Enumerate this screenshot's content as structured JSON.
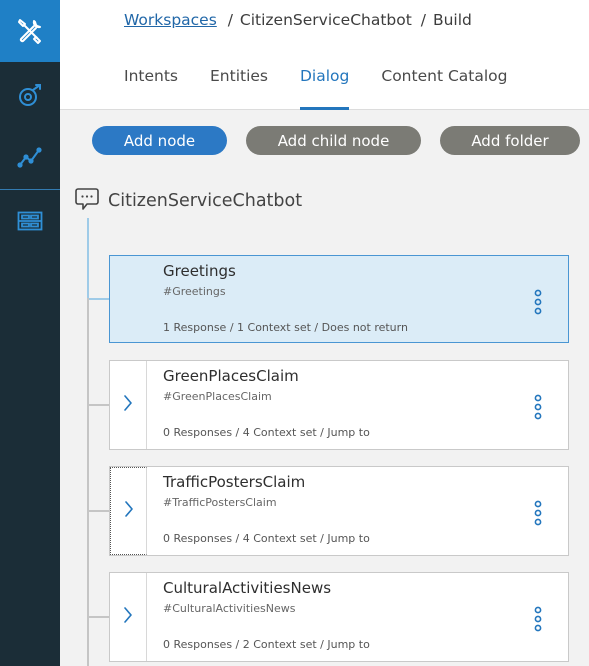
{
  "rail": {
    "items": [
      {
        "icon": "tools-icon",
        "active": true
      },
      {
        "icon": "deploy-icon",
        "active": false
      },
      {
        "icon": "analytics-icon",
        "active": false
      },
      {
        "icon": "catalog-icon",
        "active": false
      }
    ]
  },
  "breadcrumb": {
    "workspaces_link": "Workspaces",
    "separator": "/",
    "skill": "CitizenServiceChatbot",
    "page": "Build"
  },
  "tabs": [
    {
      "label": "Intents",
      "active": false
    },
    {
      "label": "Entities",
      "active": false
    },
    {
      "label": "Dialog",
      "active": true
    },
    {
      "label": "Content Catalog",
      "active": false
    }
  ],
  "toolbar": {
    "add_node": "Add node",
    "add_child_node": "Add child node",
    "add_folder": "Add folder"
  },
  "root": {
    "title": "CitizenServiceChatbot",
    "icon": "chat-bubble-icon"
  },
  "nodes": [
    {
      "title": "Greetings",
      "condition": "#Greetings",
      "meta": "1 Response / 1 Context set / Does not return",
      "selected": true,
      "has_children": false
    },
    {
      "title": "GreenPlacesClaim",
      "condition": "#GreenPlacesClaim",
      "meta": "0 Responses / 4 Context set / Jump to",
      "selected": false,
      "has_children": true
    },
    {
      "title": "TrafficPostersClaim",
      "condition": "#TrafficPostersClaim",
      "meta": "0 Responses / 4 Context set / Jump to",
      "selected": false,
      "has_children": true
    },
    {
      "title": "CulturalActivitiesNews",
      "condition": "#CulturalActivitiesNews",
      "meta": "0 Responses / 2 Context set / Jump to",
      "selected": false,
      "has_children": true
    }
  ],
  "colors": {
    "rail_bg": "#1b2d37",
    "rail_active": "#1f80c6",
    "accent": "#2376bd",
    "button_secondary": "#7b7b75",
    "selected_node_bg": "#dbecf7"
  }
}
